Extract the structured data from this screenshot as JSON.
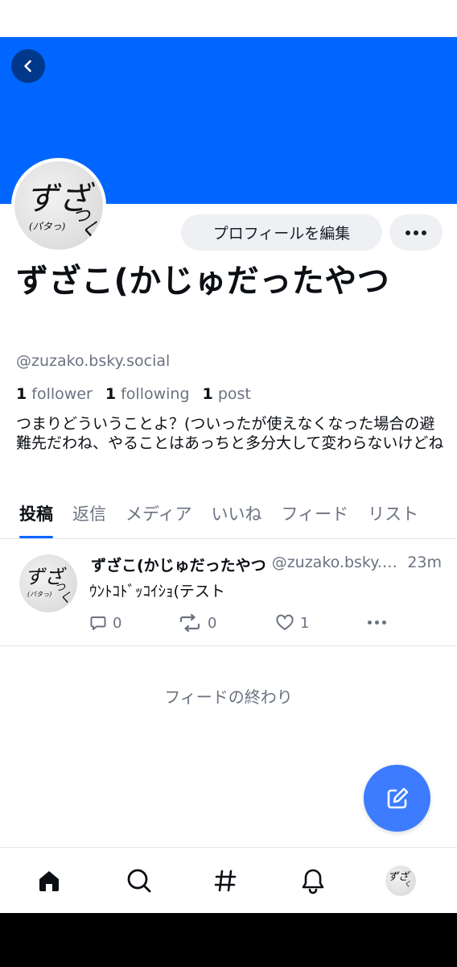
{
  "profile": {
    "display_name": "ずざこ(かじゅだったやつ",
    "handle": "@zuzako.bsky.social",
    "followers_count": "1",
    "followers_label": "follower",
    "following_count": "1",
    "following_label": "following",
    "posts_count": "1",
    "posts_label": "post",
    "bio": "つまりどういうことよ？(ついったが使えなくなった場合の避難先だわね、やることはあっちと多分大して変わらないけどね",
    "edit_button_label": "プロフィールを編集",
    "banner_color": "#0066ff"
  },
  "avatar_art": {
    "main_glyphs": "ずざ",
    "small_glyph": "つ",
    "sub_text": "(パタっ)",
    "tail_glyph": "く"
  },
  "tabs": [
    {
      "label": "投稿",
      "active": true
    },
    {
      "label": "返信",
      "active": false
    },
    {
      "label": "メディア",
      "active": false
    },
    {
      "label": "いいね",
      "active": false
    },
    {
      "label": "フィード",
      "active": false
    },
    {
      "label": "リスト",
      "active": false
    }
  ],
  "post": {
    "author": "ずざこ(かじゅだったやつ",
    "handle": "@zuzako.bsky.social",
    "time": "23m",
    "text": "ｳﾝﾄｺﾄﾞｯｺｲｼｮ(テスト",
    "reply_count": "0",
    "repost_count": "0",
    "like_count": "1"
  },
  "feed_end_label": "フィードの終わり",
  "icons": {
    "back": "chevron-left-icon",
    "more": "ellipsis-icon",
    "reply": "speech-bubble-icon",
    "repost": "repost-arrows-icon",
    "like": "heart-icon",
    "compose": "compose-icon",
    "nav_home": "home-icon",
    "nav_search": "search-icon",
    "nav_feeds": "hashtag-icon",
    "nav_notifications": "bell-icon"
  },
  "colors": {
    "accent": "#0066ff",
    "fab": "#3d7cff",
    "muted_text": "#6b7280"
  }
}
